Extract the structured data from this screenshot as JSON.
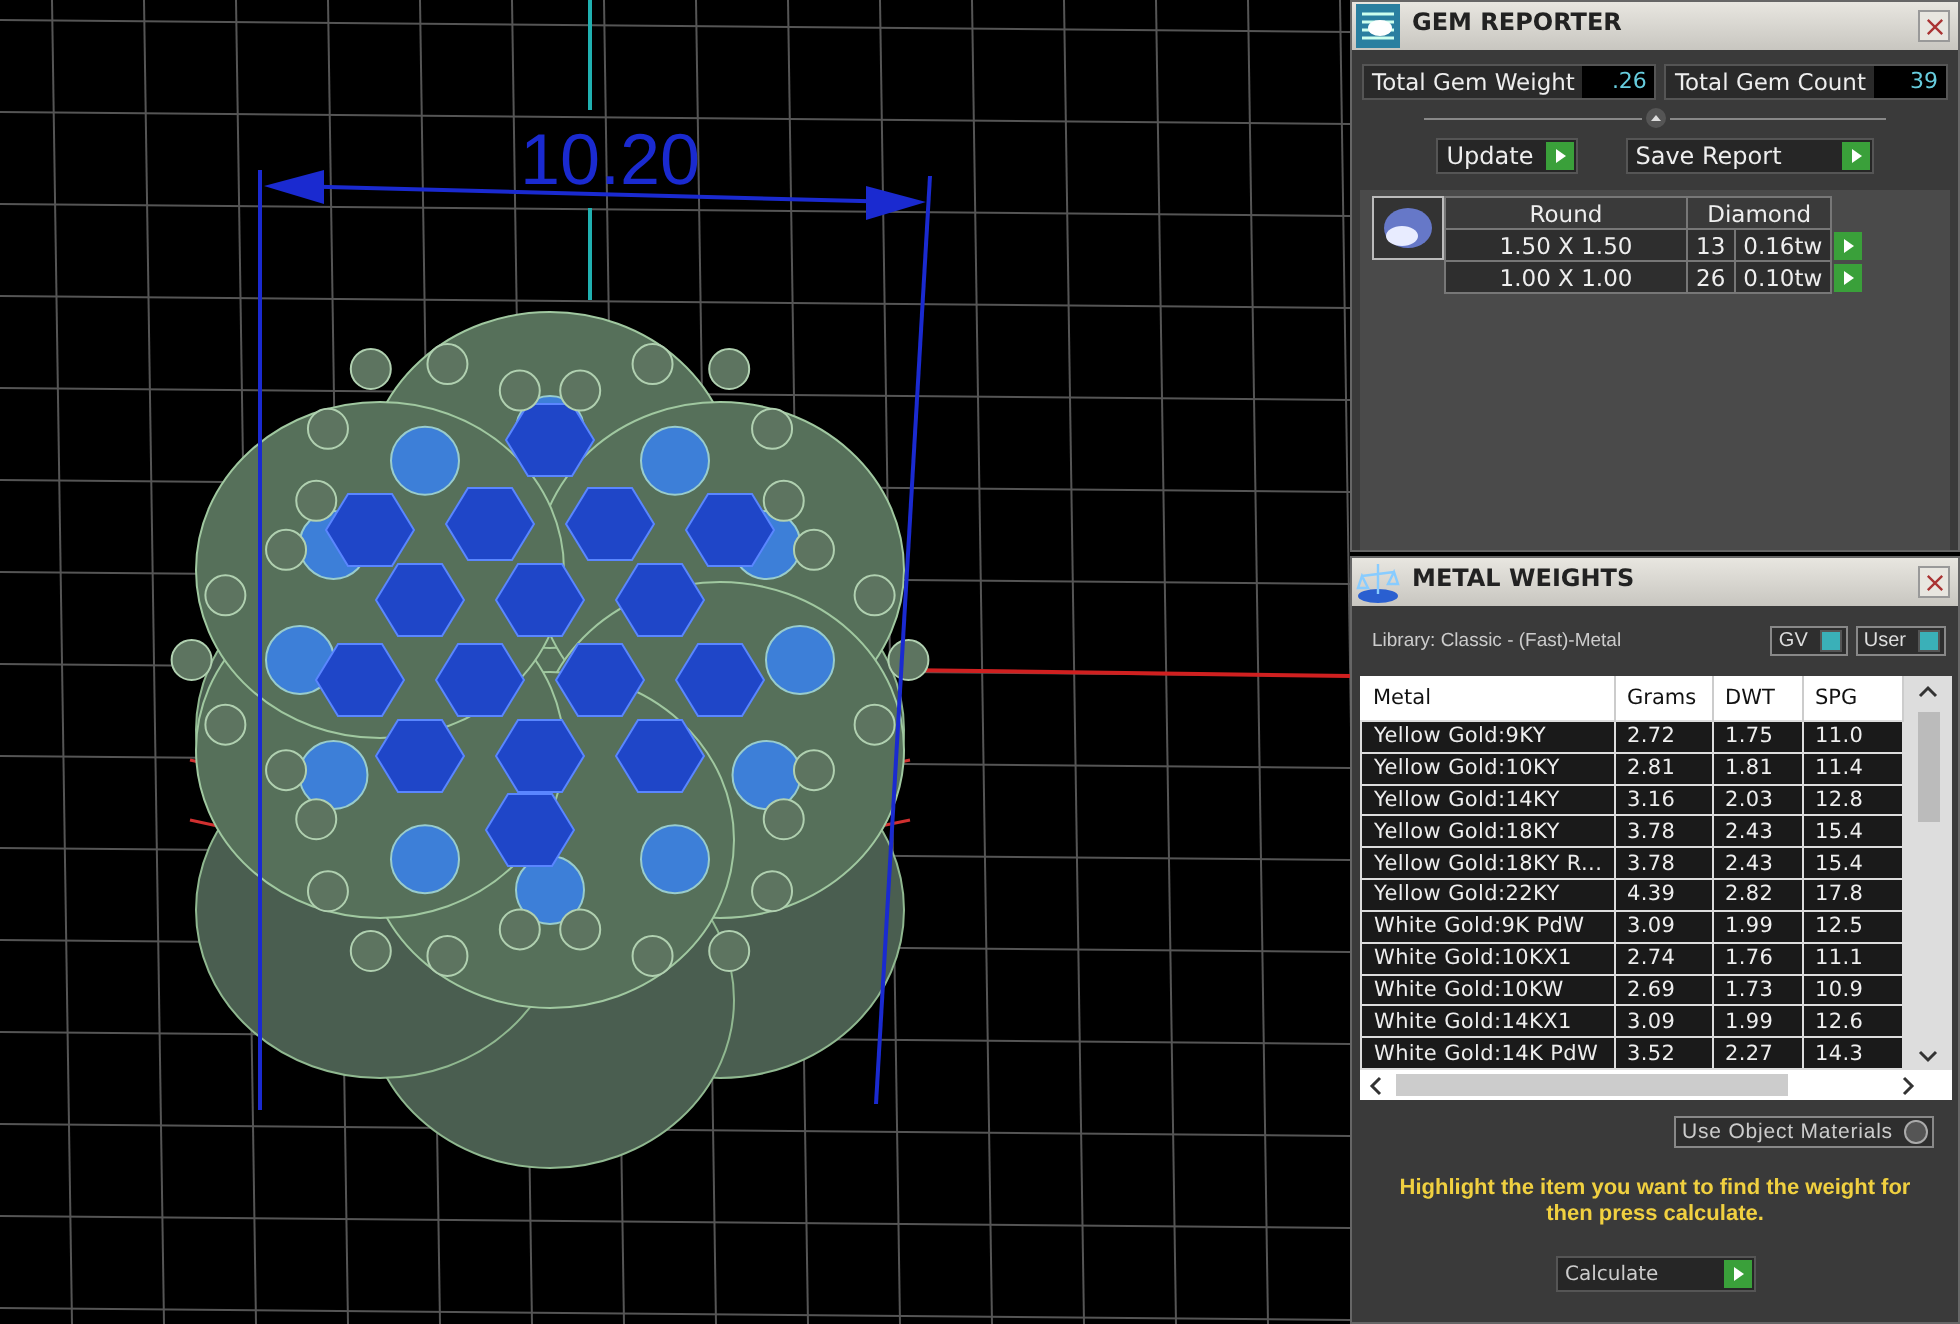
{
  "viewport": {
    "dimension": "10.20"
  },
  "gem_reporter": {
    "title": "GEM REPORTER",
    "fields": [
      {
        "label": "Total Gem Weight",
        "value": ".26"
      },
      {
        "label": "Total Gem Count",
        "value": "39"
      }
    ],
    "buttons": [
      "Update",
      "Save Report"
    ],
    "table": {
      "columns": [
        "Round",
        "Diamond"
      ],
      "rows": [
        {
          "size": "1.50 X 1.50",
          "count": "13",
          "weight": "0.16tw"
        },
        {
          "size": "1.00 X 1.00",
          "count": "26",
          "weight": "0.10tw"
        }
      ]
    }
  },
  "metal_weights": {
    "title": "METAL WEIGHTS",
    "library": "Library: Classic - (Fast)-Metal",
    "toggles": [
      {
        "label": "GV",
        "on": true
      },
      {
        "label": "User",
        "on": true
      }
    ],
    "table": {
      "columns": [
        "Metal",
        "Grams",
        "DWT",
        "SPG"
      ],
      "rows": [
        [
          "Yellow Gold:9KY",
          "2.72",
          "1.75",
          "11.0"
        ],
        [
          "Yellow Gold:10KY",
          "2.81",
          "1.81",
          "11.4"
        ],
        [
          "Yellow Gold:14KY",
          "3.16",
          "2.03",
          "12.8"
        ],
        [
          "Yellow Gold:18KY",
          "3.78",
          "2.43",
          "15.4"
        ],
        [
          "Yellow Gold:18KY R...",
          "3.78",
          "2.43",
          "15.4"
        ],
        [
          "Yellow Gold:22KY",
          "4.39",
          "2.82",
          "17.8"
        ],
        [
          "White Gold:9K PdW",
          "3.09",
          "1.99",
          "12.5"
        ],
        [
          "White Gold:10KX1",
          "2.74",
          "1.76",
          "11.1"
        ],
        [
          "White Gold:10KW",
          "2.69",
          "1.73",
          "10.9"
        ],
        [
          "White Gold:14KX1",
          "3.09",
          "1.99",
          "12.6"
        ],
        [
          "White Gold:14K PdW",
          "3.52",
          "2.27",
          "14.3"
        ]
      ]
    },
    "use_object_materials": {
      "label": "Use Object Materials",
      "on": false
    },
    "hint": "Highlight the item you want to find the weight for then press calculate.",
    "calculate": "Calculate"
  }
}
